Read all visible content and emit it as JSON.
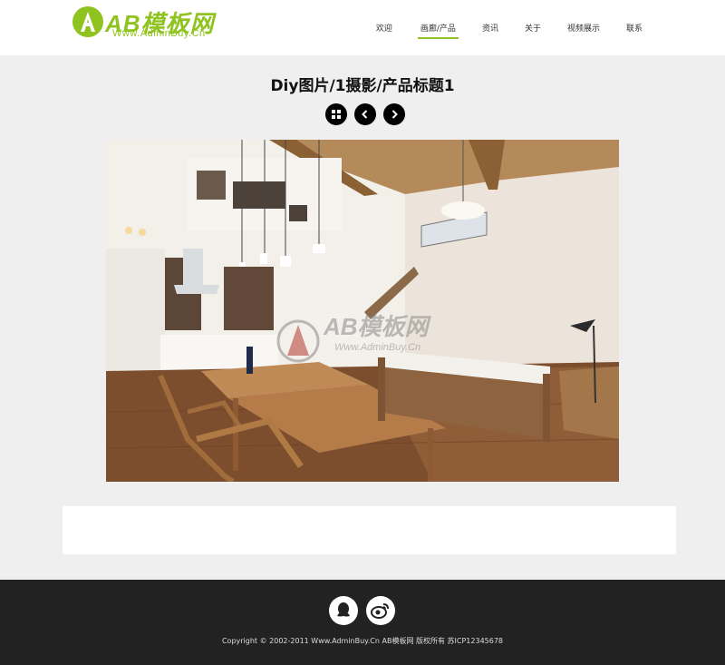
{
  "header": {
    "logo": {
      "text": "AB模板网",
      "sub": "Www.AdminBuy.Cn"
    },
    "nav": [
      {
        "label": "欢迎",
        "active": false
      },
      {
        "label": "画廊/产品",
        "active": true
      },
      {
        "label": "资讯",
        "active": false
      },
      {
        "label": "关于",
        "active": false
      },
      {
        "label": "视频展示",
        "active": false
      },
      {
        "label": "联系",
        "active": false
      }
    ]
  },
  "main": {
    "title": "Diy图片/1摄影/产品标题1",
    "controls": [
      "grid-icon",
      "chevron-left-icon",
      "chevron-right-icon"
    ],
    "photo": {
      "watermark": "AB模板网",
      "watermark_sub": "Www.AdminBuy.Cn"
    }
  },
  "footer": {
    "social": [
      "qq-icon",
      "weibo-icon"
    ],
    "copyright": "Copyright © 2002-2011 Www.AdminBuy.Cn AB模板网 版权所有   苏ICP12345678"
  },
  "colors": {
    "accent": "#8fc31f",
    "footer_bg": "#222222",
    "page_bg": "#efefef"
  }
}
